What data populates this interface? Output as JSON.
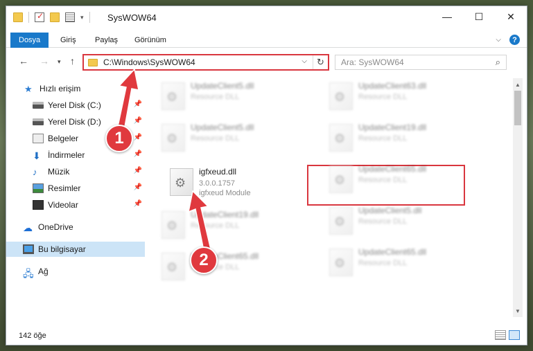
{
  "window": {
    "title": "SysWOW64",
    "controls": {
      "minimize": "—",
      "maximize": "☐",
      "close": "✕"
    }
  },
  "ribbon": {
    "tabs": [
      "Dosya",
      "Giriş",
      "Paylaş",
      "Görünüm"
    ],
    "active_tab": "Dosya",
    "accent_color": "#1979ca"
  },
  "navigation": {
    "address": "C:\\Windows\\SysWOW64",
    "search_placeholder": "Ara: SysWOW64"
  },
  "sidebar": {
    "items": [
      {
        "label": "Hızlı erişim",
        "icon": "star-icon"
      },
      {
        "label": "Yerel Disk (C:)",
        "icon": "disk-icon",
        "pinned": true
      },
      {
        "label": "Yerel Disk (D:)",
        "icon": "disk-icon",
        "pinned": true
      },
      {
        "label": "Belgeler",
        "icon": "documents-icon",
        "pinned": true
      },
      {
        "label": "İndirmeler",
        "icon": "download-icon",
        "pinned": true
      },
      {
        "label": "Müzik",
        "icon": "music-icon",
        "pinned": true
      },
      {
        "label": "Resimler",
        "icon": "pictures-icon",
        "pinned": true
      },
      {
        "label": "Videolar",
        "icon": "videos-icon",
        "pinned": true
      },
      {
        "label": "OneDrive",
        "icon": "cloud-icon"
      },
      {
        "label": "Bu bilgisayar",
        "icon": "computer-icon",
        "selected": true
      },
      {
        "label": "Ağ",
        "icon": "network-icon"
      }
    ]
  },
  "files": {
    "left": [
      {
        "name": "UpdateClient5.dll",
        "sub": "Resource DLL"
      },
      {
        "name": "UpdateClient5.dll",
        "sub": "Resource DLL"
      },
      {
        "name": "igfxeud.dll",
        "version": "3.0.0.1757",
        "sub": "igfxeud Module",
        "highlighted": true
      },
      {
        "name": "UpdateClient19.dll",
        "sub": "Resource DLL"
      },
      {
        "name": "UpdateClient65.dll",
        "sub": "Resource DLL"
      }
    ],
    "right": [
      {
        "name": "UpdateClient63.dll",
        "sub": "Resource DLL"
      },
      {
        "name": "UpdateClient19.dll",
        "sub": "Resource DLL"
      },
      {
        "name": "UpdateClient65.dll",
        "sub": "Resource DLL"
      },
      {
        "name": "UpdateClient5.dll",
        "sub": "Resource DLL"
      },
      {
        "name": "UpdateClient65.dll",
        "sub": "Resource DLL"
      }
    ]
  },
  "status": {
    "item_count": "142 öğe"
  },
  "annotations": {
    "step1": "1",
    "step2": "2",
    "color": "#e0393e"
  }
}
